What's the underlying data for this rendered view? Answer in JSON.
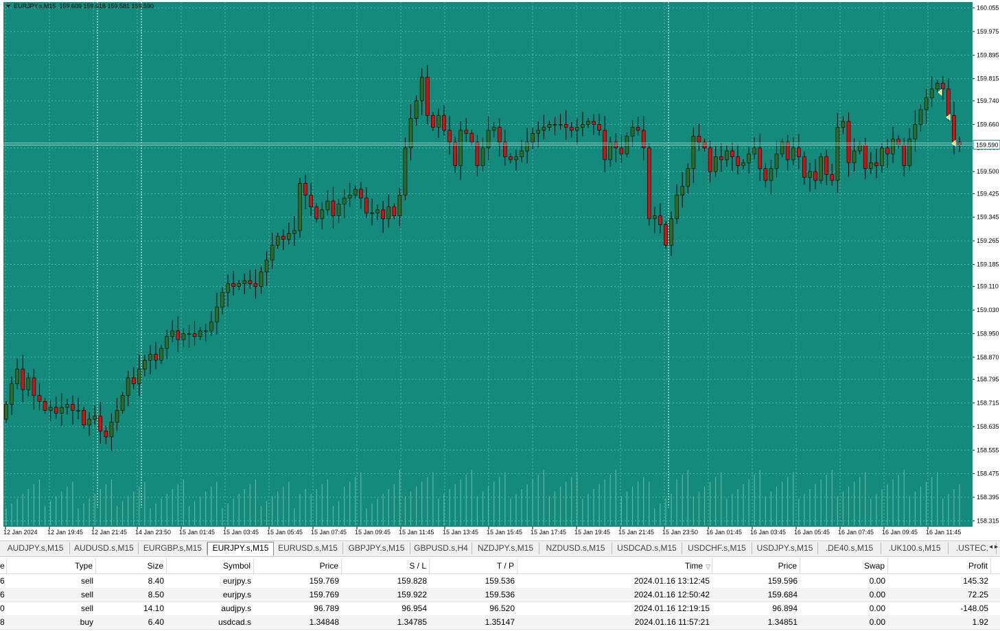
{
  "chart": {
    "title": "EURJPY.s,M15",
    "ohlc": "159.609 159.618 159.581 159.590",
    "current_price_label": "159.590",
    "colors": {
      "background": "#148a7c",
      "grid": "#4fb8ac",
      "bull": "#2e6a28",
      "bear": "#d61010",
      "volume": "#5ab5ab"
    }
  },
  "chart_data": {
    "type": "candlestick",
    "symbol": "EURJPY.s",
    "timeframe": "M15",
    "y_ticks": [
      "160.055",
      "159.975",
      "159.895",
      "159.815",
      "159.740",
      "159.660",
      "159.580",
      "159.500",
      "159.425",
      "159.345",
      "159.265",
      "159.185",
      "159.110",
      "159.030",
      "158.950",
      "158.870",
      "158.795",
      "158.715",
      "158.635",
      "158.555",
      "158.475",
      "158.395",
      "158.315"
    ],
    "x_ticks": [
      "12 Jan 2024",
      "12 Jan 19:45",
      "12 Jan 21:45",
      "14 Jan 23:50",
      "15 Jan 01:45",
      "15 Jan 03:45",
      "15 Jan 05:45",
      "15 Jan 07:45",
      "15 Jan 09:45",
      "15 Jan 11:45",
      "15 Jan 13:45",
      "15 Jan 15:45",
      "15 Jan 17:45",
      "15 Jan 19:45",
      "15 Jan 21:45",
      "15 Jan 23:50",
      "16 Jan 01:45",
      "16 Jan 03:45",
      "16 Jan 05:45",
      "16 Jan 07:45",
      "16 Jan 09:45",
      "16 Jan 11:45"
    ],
    "closes": [
      158.71,
      158.78,
      158.83,
      158.76,
      158.8,
      158.74,
      158.72,
      158.69,
      158.7,
      158.68,
      158.7,
      158.71,
      158.69,
      158.69,
      158.64,
      158.66,
      158.67,
      158.62,
      158.6,
      158.65,
      158.69,
      158.74,
      158.8,
      158.78,
      158.83,
      158.86,
      158.88,
      158.86,
      158.9,
      158.94,
      158.96,
      158.93,
      158.95,
      158.95,
      158.94,
      158.96,
      158.96,
      158.99,
      159.04,
      159.09,
      159.12,
      159.11,
      159.12,
      159.13,
      159.12,
      159.11,
      159.16,
      159.2,
      159.25,
      159.28,
      159.27,
      159.29,
      159.3,
      159.46,
      159.42,
      159.38,
      159.34,
      159.37,
      159.4,
      159.35,
      159.39,
      159.41,
      159.42,
      159.44,
      159.41,
      159.36,
      159.36,
      159.37,
      159.34,
      159.38,
      159.35,
      159.42,
      159.58,
      159.68,
      159.74,
      159.82,
      159.69,
      159.65,
      159.69,
      159.64,
      159.6,
      159.52,
      159.64,
      159.63,
      159.6,
      159.52,
      159.58,
      159.64,
      159.65,
      159.6,
      159.55,
      159.54,
      159.55,
      159.57,
      159.6,
      159.63,
      159.64,
      159.65,
      159.66,
      159.66,
      159.66,
      159.65,
      159.64,
      159.65,
      159.66,
      159.67,
      159.66,
      159.64,
      159.54,
      159.6,
      159.58,
      159.56,
      159.62,
      159.65,
      159.64,
      159.58,
      159.34,
      159.35,
      159.32,
      159.25,
      159.34,
      159.42,
      159.45,
      159.51,
      159.62,
      159.6,
      159.58,
      159.5,
      159.55,
      159.54,
      159.57,
      159.55,
      159.52,
      159.53,
      159.56,
      159.58,
      159.51,
      159.47,
      159.51,
      159.56,
      159.6,
      159.54,
      159.58,
      159.55,
      159.48,
      159.5,
      159.47,
      159.55,
      159.49,
      159.47,
      159.65,
      159.67,
      159.53,
      159.57,
      159.59,
      159.51,
      159.53,
      159.52,
      159.58,
      159.56,
      159.61,
      159.59,
      159.52,
      159.61,
      159.66,
      159.71,
      159.75,
      159.78,
      159.8,
      159.78,
      159.69,
      159.6,
      159.59
    ],
    "position_markers": [
      159.769,
      159.684,
      159.596
    ]
  },
  "tabs": [
    {
      "label": "AUDJPY.s,M15"
    },
    {
      "label": "AUDUSD.s,M15"
    },
    {
      "label": "EURGBP.s,M15"
    },
    {
      "label": "EURJPY.s,M15",
      "active": true
    },
    {
      "label": "EURUSD.s,M15"
    },
    {
      "label": "GBPJPY.s,M15"
    },
    {
      "label": "GBPUSD.s,H4"
    },
    {
      "label": "NZDJPY.s,M15"
    },
    {
      "label": "NZDUSD.s,M15"
    },
    {
      "label": "USDCAD.s,M15"
    },
    {
      "label": "USDCHF.s,M15"
    },
    {
      "label": "USDJPY.s,M15"
    },
    {
      "label": ".DE40.s,M15"
    },
    {
      "label": ".UK100.s,M15"
    },
    {
      "label": ".USTEC."
    }
  ],
  "tab_scroll_arrows": "◂ ▸",
  "table": {
    "headers": [
      "e",
      "Type",
      "Size",
      "Symbol",
      "Price",
      "S / L",
      "T / P",
      "Time",
      "Price",
      "Swap",
      "Profit"
    ],
    "sort_icon": "▽",
    "rows": [
      [
        "6",
        "sell",
        "8.40",
        "eurjpy.s",
        "159.769",
        "159.828",
        "159.536",
        "2024.01.16 13:12:45",
        "159.596",
        "0.00",
        "145.32"
      ],
      [
        "6",
        "sell",
        "8.50",
        "eurjpy.s",
        "159.769",
        "159.922",
        "159.536",
        "2024.01.16 12:50:42",
        "159.684",
        "0.00",
        "72.25"
      ],
      [
        "0",
        "sell",
        "14.10",
        "audjpy.s",
        "96.789",
        "96.954",
        "96.520",
        "2024.01.16 12:19:15",
        "96.894",
        "0.00",
        "-148.05"
      ],
      [
        "8",
        "buy",
        "6.40",
        "usdcad.s",
        "1.34848",
        "1.34785",
        "1.35147",
        "2024.01.16 11:57:21",
        "1.34851",
        "0.00",
        "1.92"
      ]
    ]
  }
}
